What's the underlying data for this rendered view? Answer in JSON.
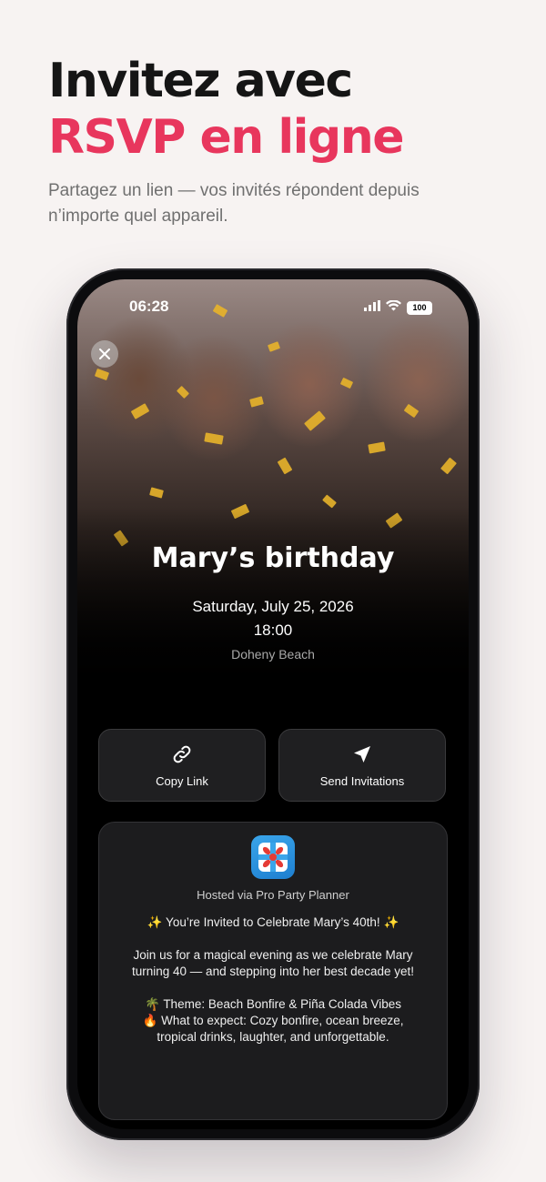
{
  "promo": {
    "headline_line1": "Invitez avec",
    "headline_line2": "RSVP en ligne",
    "subtitle": "Partagez un lien — vos invités répondent depuis n’importe quel appareil.",
    "accent_color": "#e8365d"
  },
  "status_bar": {
    "time": "06:28",
    "battery": "100",
    "icons": [
      "signal-icon",
      "wifi-icon",
      "battery-icon"
    ]
  },
  "event": {
    "close_icon": "close-icon",
    "title": "Mary’s birthday",
    "date": "Saturday, July 25, 2026",
    "time": "18:00",
    "location": "Doheny Beach"
  },
  "actions": {
    "copy_link": {
      "label": "Copy Link",
      "icon": "link-icon"
    },
    "send_invitations": {
      "label": "Send Invitations",
      "icon": "send-icon"
    }
  },
  "card": {
    "app_icon": "gift-app-icon",
    "hosted": "Hosted via Pro Party Planner",
    "description": "✨ You’re Invited to Celebrate Mary’s 40th! ✨\n\nJoin us for a magical evening as we celebrate Mary turning 40 — and stepping into her best decade yet!\n\n🌴 Theme: Beach Bonfire & Piña Colada Vibes\n🔥 What to expect: Cozy bonfire, ocean breeze, tropical drinks, laughter, and unforgettable."
  }
}
